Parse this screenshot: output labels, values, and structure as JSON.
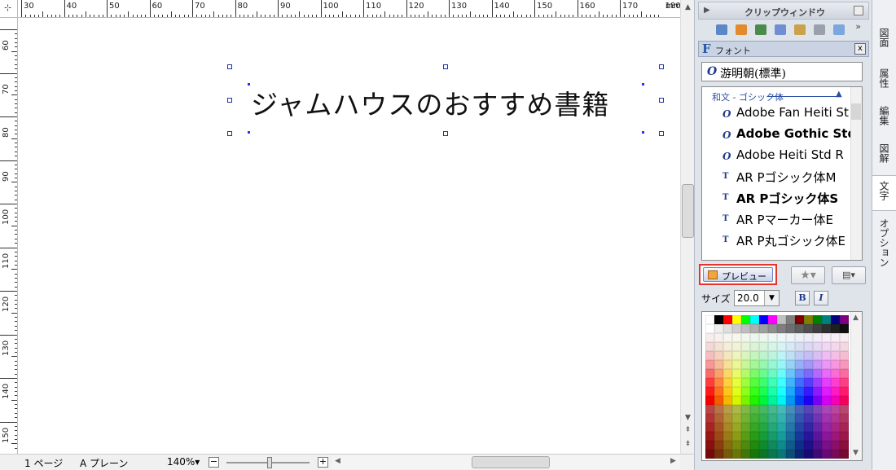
{
  "ruler": {
    "corner_symbol": "⊹",
    "h_labels": [
      "30",
      "40",
      "50",
      "60",
      "70",
      "80",
      "90",
      "100",
      "110",
      "120",
      "130",
      "140",
      "150",
      "160",
      "170",
      "180"
    ],
    "h_unit": "mm",
    "v_labels": [
      "60",
      "70",
      "80",
      "90",
      "100",
      "110",
      "120",
      "130",
      "140",
      "150"
    ]
  },
  "canvas": {
    "text": "ジャムハウスのおすすめ書籍"
  },
  "status": {
    "page": "1 ページ",
    "layer": "A プレーン",
    "zoom": "140%▾",
    "zoom_out": "−",
    "zoom_in": "+"
  },
  "clip_window": {
    "title": "クリップウィンドウ",
    "more": "»"
  },
  "font_panel": {
    "header_icon": "F",
    "title": "フォント",
    "close": "x",
    "current_font": "游明朝(標準)",
    "group_label": "和文 - ゴシック体",
    "fonts": [
      {
        "name": "Adobe Fan Heiti St",
        "type": "opentype",
        "weight": "normal"
      },
      {
        "name": "Adobe Gothic Std B",
        "type": "opentype",
        "weight": "bold"
      },
      {
        "name": "Adobe Heiti Std R",
        "type": "opentype",
        "weight": "normal"
      },
      {
        "name": "AR Pゴシック体M",
        "type": "truetype",
        "weight": "normal"
      },
      {
        "name": "AR Pゴシック体S",
        "type": "truetype",
        "weight": "bold"
      },
      {
        "name": "AR Pマーカー体E",
        "type": "truetype",
        "weight": "normal"
      },
      {
        "name": "AR P丸ゴシック体E",
        "type": "truetype",
        "weight": "normal"
      }
    ],
    "preview_label": "プレビュー",
    "size_label": "サイズ",
    "size_value": "20.0",
    "bold_label": "B",
    "italic_label": "I"
  },
  "side_tabs": [
    "図面",
    "属性",
    "編集",
    "図解",
    "文字",
    "オプション"
  ],
  "active_tab": "文字",
  "colors": {
    "accent": "#2a55a8",
    "highlight_border": "#e8332b"
  }
}
